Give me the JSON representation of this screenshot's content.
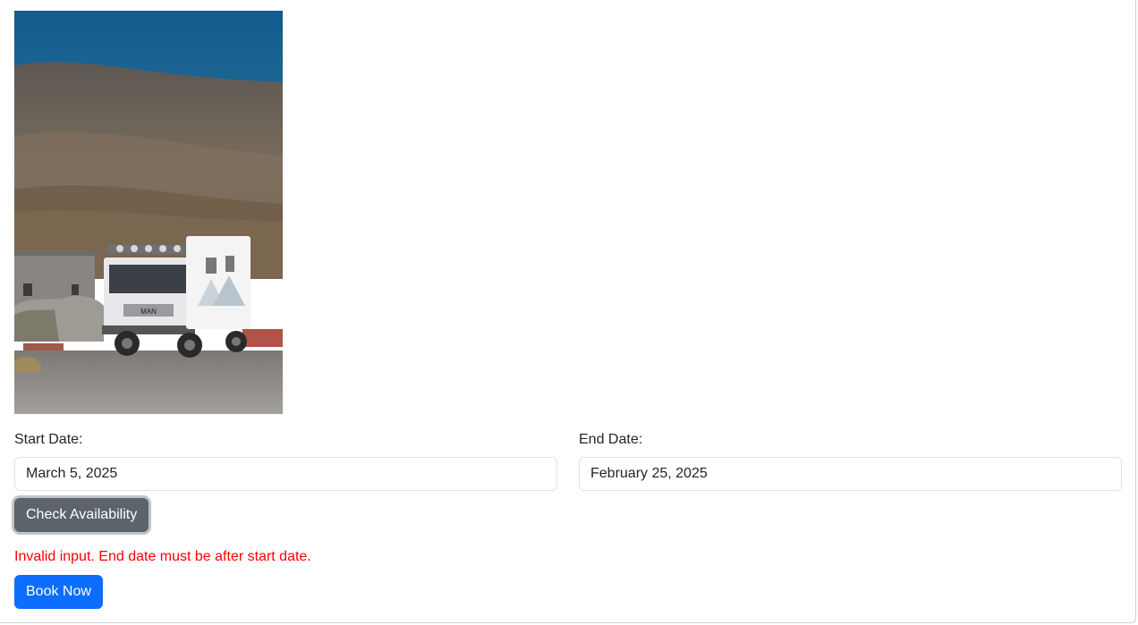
{
  "photo": {
    "icon": "camper-truck-photo",
    "description_colors": {
      "sky": "#1a5a8a",
      "hills": "#6e6558",
      "ground": "#8a8783",
      "truck_body": "#f2f2f2"
    },
    "brand_text": "MAN"
  },
  "booking": {
    "start_label": "Start Date:",
    "start_value": "March 5, 2025",
    "end_label": "End Date:",
    "end_value": "February 25, 2025",
    "check_button": "Check Availability",
    "error_message": "Invalid input. End date must be after start date.",
    "book_button": "Book Now"
  },
  "colors": {
    "primary": "#0d6efd",
    "secondary": "#5c636a",
    "error": "#ff0000"
  }
}
